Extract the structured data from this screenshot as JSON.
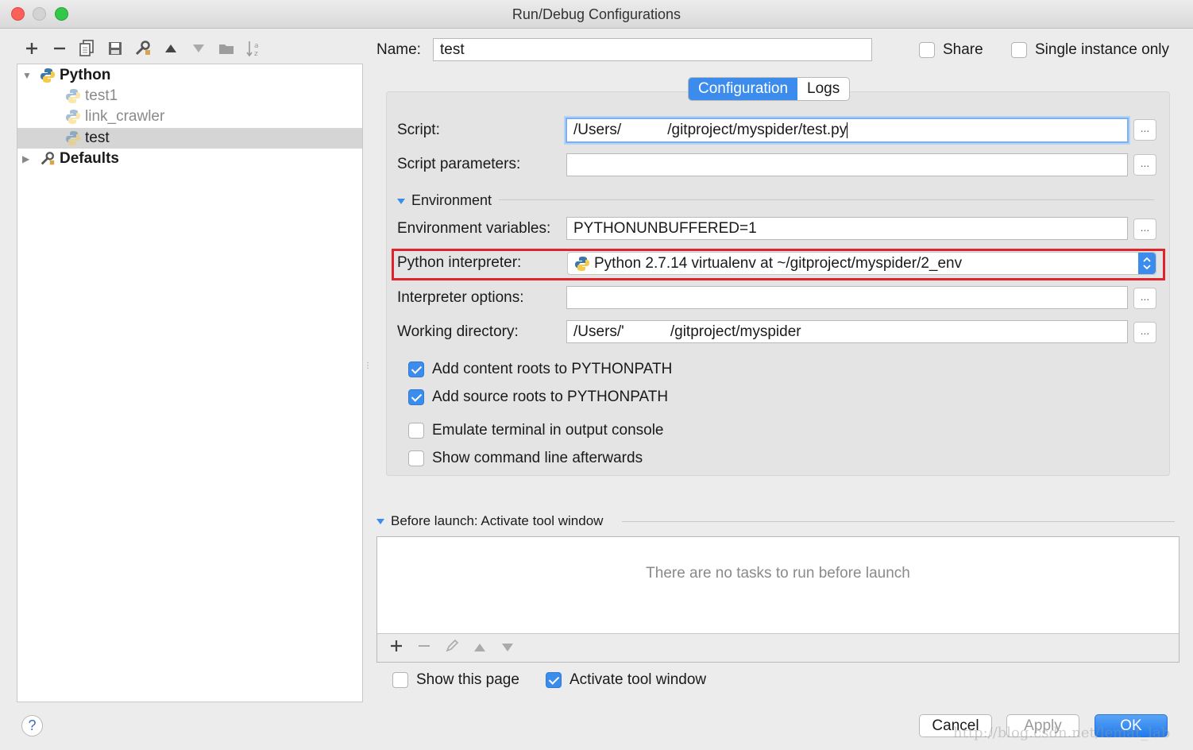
{
  "window": {
    "title": "Run/Debug Configurations"
  },
  "toolbar": {
    "buttons": [
      "plus-icon",
      "minus-icon",
      "copy-icon",
      "save-icon",
      "wrench-icon",
      "arrow-up-icon",
      "arrow-down-icon",
      "folder-icon",
      "sort-icon"
    ]
  },
  "tree": {
    "python_label": "Python",
    "items": [
      "test1",
      "link_crawler",
      "test"
    ],
    "defaults_label": "Defaults"
  },
  "header": {
    "name_label": "Name:",
    "name_value": "test",
    "share_label": "Share",
    "single_instance_label": "Single instance only"
  },
  "tabs": {
    "configuration": "Configuration",
    "logs": "Logs"
  },
  "config": {
    "script_label": "Script:",
    "script_value": "/Users/           /gitproject/myspider/test.py",
    "script_params_label": "Script parameters:",
    "script_params_value": "",
    "environment_label": "Environment",
    "env_vars_label": "Environment variables:",
    "env_vars_value": "PYTHONUNBUFFERED=1",
    "interpreter_label": "Python interpreter:",
    "interpreter_value": "Python 2.7.14 virtualenv at ~/gitproject/myspider/2_env",
    "interp_options_label": "Interpreter options:",
    "interp_options_value": "",
    "working_dir_label": "Working directory:",
    "working_dir_value": "/Users/'           /gitproject/myspider",
    "browse": "...",
    "checks": {
      "content_roots": {
        "label": "Add content roots to PYTHONPATH",
        "checked": true
      },
      "source_roots": {
        "label": "Add source roots to PYTHONPATH",
        "checked": true
      },
      "emulate_terminal": {
        "label": "Emulate terminal in output console",
        "checked": false
      },
      "show_cmdline": {
        "label": "Show command line afterwards",
        "checked": false
      }
    }
  },
  "before_launch": {
    "title": "Before launch: Activate tool window",
    "empty_text": "There are no tasks to run before launch",
    "show_page_label": "Show this page",
    "show_page_checked": false,
    "activate_label": "Activate tool window",
    "activate_checked": true
  },
  "footer": {
    "help": "?",
    "cancel": "Cancel",
    "apply": "Apply",
    "ok": "OK"
  },
  "watermark": "http://blog.csdn.net/lemat_lab",
  "colors": {
    "accent": "#3b8ced",
    "highlight": "#e0242b",
    "selected_row": "#d5d5d5"
  }
}
